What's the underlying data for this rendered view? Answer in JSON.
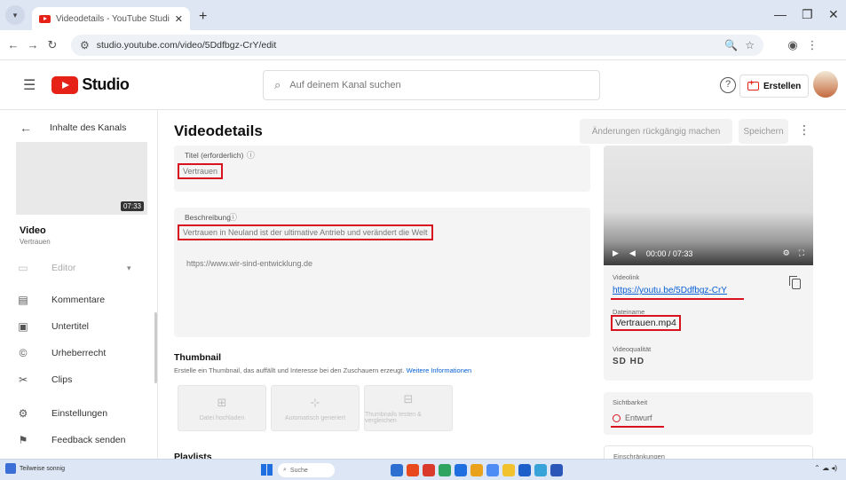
{
  "browser": {
    "tab_title": "Videodetails - YouTube Studio",
    "url": "studio.youtube.com/video/5Ddfbgz-CrY/edit"
  },
  "header": {
    "logo_text": "Studio",
    "search_placeholder": "Auf deinem Kanal suchen",
    "create_label": "Erstellen"
  },
  "sidebar": {
    "back_label": "Inhalte des Kanals",
    "thumb_duration": "07:33",
    "video_label": "Video",
    "video_sub": "Vertrauen",
    "items": [
      {
        "label": "Editor",
        "icon": "editor-icon",
        "dim": true
      },
      {
        "label": "Kommentare",
        "icon": "comments-icon"
      },
      {
        "label": "Untertitel",
        "icon": "subtitles-icon"
      },
      {
        "label": "Urheberrecht",
        "icon": "copyright-icon"
      },
      {
        "label": "Clips",
        "icon": "clips-icon"
      },
      {
        "label": "Einstellungen",
        "icon": "settings-icon"
      },
      {
        "label": "Feedback senden",
        "icon": "feedback-icon"
      }
    ]
  },
  "main": {
    "title": "Videodetails",
    "undo_label": "Änderungen rückgängig machen",
    "save_label": "Speichern",
    "title_field": {
      "label": "Titel (erforderlich)",
      "value": "Vertrauen"
    },
    "desc_field": {
      "label": "Beschreibung",
      "value": "Vertrauen in Neuland ist der ultimative Antrieb und verändert die Welt",
      "link": "https://www.wir-sind-entwicklung.de"
    },
    "thumbnail": {
      "title": "Thumbnail",
      "desc": "Erstelle ein Thumbnail, das auffällt und Interesse bei den Zuschauern erzeugt.",
      "more": "Weitere Informationen",
      "options": [
        "Datei hochladen",
        "Automatisch generiert",
        "Thumbnails testen & vergleichen"
      ]
    },
    "playlist_title": "Playlists"
  },
  "right": {
    "player_time": "00:00 / 07:33",
    "link_label": "Videolink",
    "link_url": "https://youtu.be/5Ddfbgz-CrY",
    "filename_label": "Dateiname",
    "filename": "Vertrauen.mp4",
    "quality_label": "Videoqualität",
    "quality_value": "SD HD",
    "visibility_label": "Sichtbarkeit",
    "visibility_value": "Entwurf",
    "restrictions_label": "Einschränkungen"
  },
  "taskbar": {
    "weather": "Teilweise sonnig",
    "search_label": "Suche"
  },
  "colors": {
    "accent_red": "#d8131f",
    "link_blue": "#065fd4"
  }
}
